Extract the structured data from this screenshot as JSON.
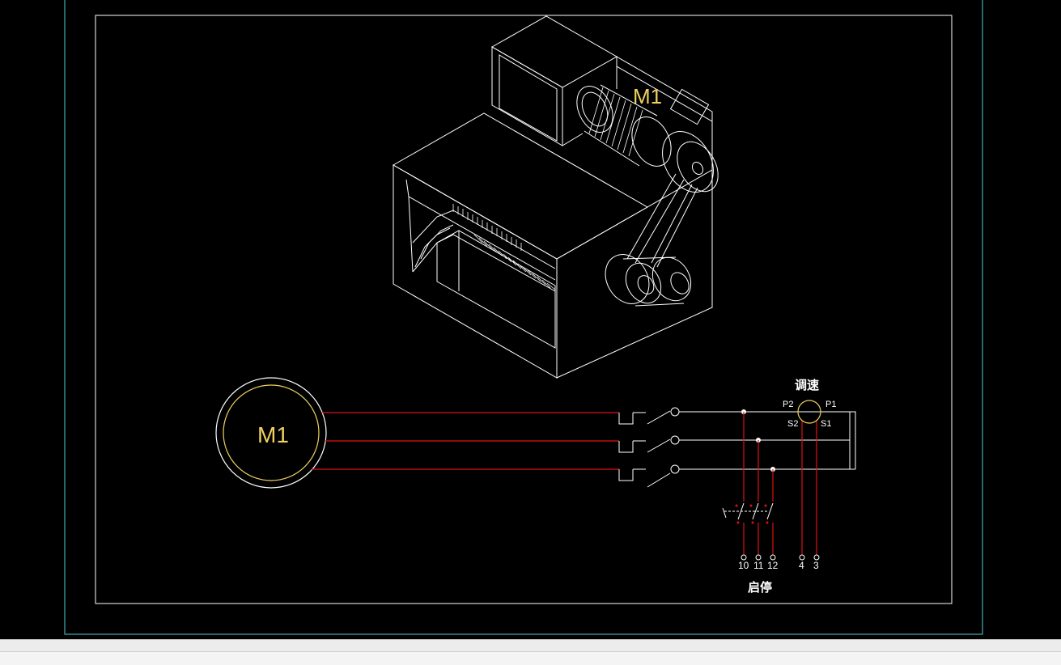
{
  "drawing": {
    "machine_motor_label": "M1",
    "motor_label": "M1",
    "speed_control_title": "调速",
    "pot_terminals": {
      "p2": "P2",
      "p1": "P1",
      "s2": "S2",
      "s1": "S1"
    },
    "start_stop_label": "启停",
    "terminal_numbers": [
      "10",
      "11",
      "12",
      "4",
      "3"
    ]
  },
  "colors": {
    "background": "#000000",
    "line": "#ffffff",
    "wire": "#e01010",
    "label": "#f0d060",
    "frame": "#4fd0d8"
  }
}
